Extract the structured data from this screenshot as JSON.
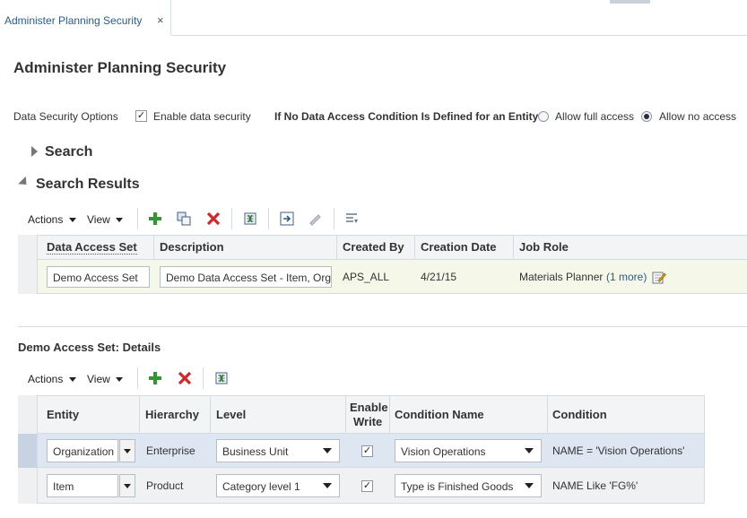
{
  "tab": {
    "label": "Administer Planning Security",
    "close": "×"
  },
  "page_title": "Administer Planning Security",
  "options": {
    "label": "Data Security Options",
    "enable_label": "Enable data security",
    "enable_checked": true,
    "no_condition_label": "If No Data Access Condition Is Defined for an Entity",
    "allow_full_label": "Allow full access",
    "allow_none_label": "Allow no access",
    "selected": "Allow no access"
  },
  "search": {
    "title": "Search"
  },
  "results": {
    "title": "Search Results",
    "toolbar": {
      "actions": "Actions",
      "view": "View"
    },
    "columns": [
      "Data Access Set",
      "Description",
      "Created By",
      "Creation Date",
      "Job Role"
    ],
    "rows": [
      {
        "data_access_set": "Demo Access Set",
        "description": "Demo Data Access Set - Item, Org",
        "created_by": "APS_ALL",
        "creation_date": "4/21/15",
        "job_role": "Materials Planner",
        "job_role_more": "(1 more)"
      }
    ]
  },
  "details": {
    "title": "Demo Access Set: Details",
    "toolbar": {
      "actions": "Actions",
      "view": "View"
    },
    "columns": {
      "entity": "Entity",
      "hierarchy": "Hierarchy",
      "level": "Level",
      "enable_write_1": "Enable",
      "enable_write_2": "Write",
      "condition_name": "Condition Name",
      "condition": "Condition"
    },
    "rows": [
      {
        "entity": "Organization",
        "hierarchy": "Enterprise",
        "level": "Business Unit",
        "enable_write": true,
        "condition_name": "Vision Operations",
        "condition": "NAME = 'Vision Operations'"
      },
      {
        "entity": "Item",
        "hierarchy": "Product",
        "level": "Category level 1",
        "enable_write": true,
        "condition_name": "Type is Finished Goods",
        "condition": "NAME Like 'FG%'"
      }
    ]
  }
}
